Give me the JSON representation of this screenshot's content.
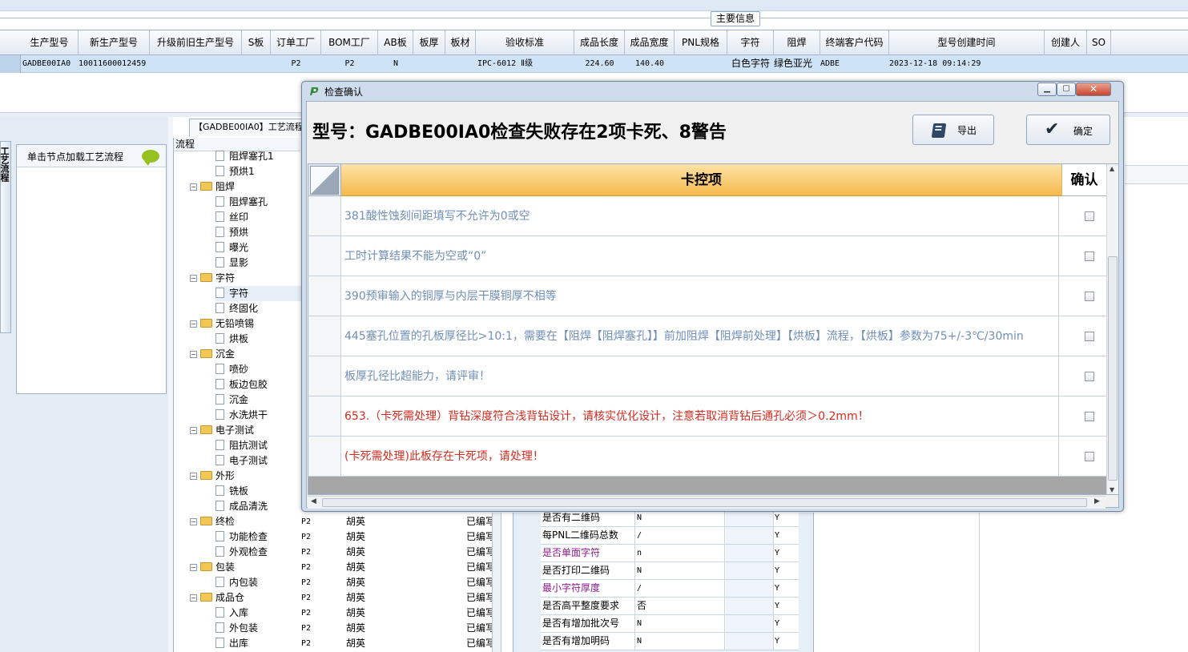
{
  "main_info_label": "主要信息",
  "header_columns": [
    "生产型号",
    "新生产型号",
    "升级前旧生产型号",
    "S板",
    "订单工厂",
    "BOM工厂",
    "AB板",
    "板厚",
    "板材",
    "验收标准",
    "成品长度",
    "成品宽度",
    "PNL规格",
    "字符",
    "阻焊",
    "终端客户代码",
    "型号创建时间",
    "创建人",
    "SO"
  ],
  "data_row": [
    "GADBE00IA0",
    "10011600012459",
    "",
    "",
    "P2",
    "P2",
    "N",
    "",
    "",
    "IPC-6012 Ⅱ级",
    "224.60",
    "140.40",
    "",
    "白色字符",
    "绿色亚光",
    "ADBE",
    "2023-12-18 09:14:29",
    "",
    ""
  ],
  "left_panel": {
    "vertical_tab": "工艺流程",
    "box_title": "单击节点加载工艺流程"
  },
  "flow_tab_label": "【GADBE00IA0】工艺流程",
  "tree_header": "流程",
  "tree_nodes": [
    {
      "type": "leaf",
      "label": "阻焊塞孔1"
    },
    {
      "type": "leaf",
      "label": "预烘1"
    },
    {
      "type": "folder",
      "label": "阻焊"
    },
    {
      "type": "leaf",
      "label": "阻焊塞孔"
    },
    {
      "type": "leaf",
      "label": "丝印"
    },
    {
      "type": "leaf",
      "label": "预烘"
    },
    {
      "type": "leaf",
      "label": "曝光"
    },
    {
      "type": "leaf",
      "label": "显影"
    },
    {
      "type": "folder",
      "label": "字符"
    },
    {
      "type": "leaf",
      "label": "字符",
      "selected": true
    },
    {
      "type": "leaf",
      "label": "终固化"
    },
    {
      "type": "folder",
      "label": "无铅喷锡"
    },
    {
      "type": "leaf",
      "label": "烘板"
    },
    {
      "type": "folder",
      "label": "沉金"
    },
    {
      "type": "leaf",
      "label": "喷砂"
    },
    {
      "type": "leaf",
      "label": "板边包胶"
    },
    {
      "type": "leaf",
      "label": "沉金"
    },
    {
      "type": "leaf",
      "label": "水洗烘干"
    },
    {
      "type": "folder",
      "label": "电子测试"
    },
    {
      "type": "leaf",
      "label": "阻抗测试"
    },
    {
      "type": "leaf",
      "label": "电子测试"
    },
    {
      "type": "folder",
      "label": "外形"
    },
    {
      "type": "leaf",
      "label": "铣板"
    },
    {
      "type": "leaf",
      "label": "成品清洗"
    },
    {
      "type": "folder",
      "label": "终检"
    },
    {
      "type": "leaf",
      "label": "功能检查"
    },
    {
      "type": "leaf",
      "label": "外观检查"
    },
    {
      "type": "folder",
      "label": "包装"
    },
    {
      "type": "leaf",
      "label": "内包装"
    },
    {
      "type": "folder",
      "label": "成品仓"
    },
    {
      "type": "leaf",
      "label": "入库"
    },
    {
      "type": "leaf",
      "label": "外包装"
    },
    {
      "type": "leaf",
      "label": "出库"
    }
  ],
  "mid_rows": [
    {
      "factory": "P2",
      "person": "胡英",
      "status": "已编写"
    },
    {
      "factory": "P2",
      "person": "胡英",
      "status": "已编写"
    },
    {
      "factory": "P2",
      "person": "胡英",
      "status": "已编写"
    },
    {
      "factory": "P2",
      "person": "胡英",
      "status": "已编写"
    },
    {
      "factory": "P2",
      "person": "胡英",
      "status": "已编写"
    },
    {
      "factory": "P2",
      "person": "胡英",
      "status": "已编写"
    },
    {
      "factory": "P2",
      "person": "胡英",
      "status": "已编写"
    },
    {
      "factory": "P2",
      "person": "胡英",
      "status": "已编写"
    },
    {
      "factory": "P2",
      "person": "胡英",
      "status": "已编写"
    }
  ],
  "param_rows": [
    {
      "label": "是否有二维码",
      "value": "N",
      "flag": "Y",
      "magenta": false
    },
    {
      "label": "每PNL二维码总数",
      "value": "/",
      "flag": "Y",
      "magenta": false
    },
    {
      "label": "是否单面字符",
      "value": "n",
      "flag": "Y",
      "magenta": true
    },
    {
      "label": "是否打印二维码",
      "value": "N",
      "flag": "Y",
      "magenta": false
    },
    {
      "label": "最小字符厚度",
      "value": "/",
      "flag": "Y",
      "magenta": true
    },
    {
      "label": "是否高平整度要求",
      "value": "否",
      "flag": "Y",
      "magenta": false
    },
    {
      "label": "是否有增加批次号",
      "value": "N",
      "flag": "Y",
      "magenta": false
    },
    {
      "label": "是否有增加明码",
      "value": "N",
      "flag": "Y",
      "magenta": false
    }
  ],
  "dialog": {
    "title": "检查确认",
    "header": "型号：GADBE00IA0检查失败存在2项卡死、8警告",
    "export_label": "导出",
    "confirm_label": "确定",
    "column_control": "卡控项",
    "column_confirm": "确认",
    "items": [
      {
        "text": "381酸性蚀刻间距填写不允许为0或空",
        "severity": "warning"
      },
      {
        "text": "工时计算结果不能为空或“0”",
        "severity": "warning"
      },
      {
        "text": "390预审输入的铜厚与内层干膜铜厚不相等",
        "severity": "warning"
      },
      {
        "text": "445塞孔位置的孔板厚径比>10:1，需要在【阻焊【阻焊塞孔】】前加阻焊【阻焊前处理】【烘板】流程，【烘板】参数为75+/-3℃/30min",
        "severity": "warning"
      },
      {
        "text": "板厚孔径比超能力，请评审！",
        "severity": "warning"
      },
      {
        "text": "653.（卡死需处理）背钻深度符合浅背钻设计，请核实优化设计，注意若取消背钻后通孔必须＞0.2mm！",
        "severity": "block"
      },
      {
        "text": "(卡死需处理)此板存在卡死项，请处理！",
        "severity": "block"
      }
    ]
  },
  "colors": {
    "warning_text": "#6f8fb8",
    "block_text": "#d92b1f",
    "grid_header": "#f5b94d",
    "selected_row": "#cfe3f7"
  }
}
